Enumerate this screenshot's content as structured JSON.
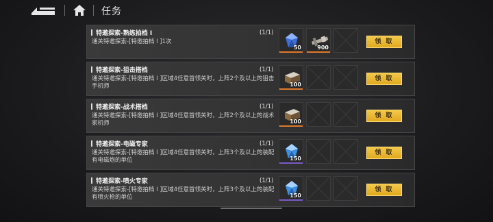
{
  "header": {
    "title": "任务",
    "back_icon": "back-arrow-icon",
    "home_icon": "home-icon"
  },
  "colors": {
    "claim_button": "#e8b32a",
    "rarity_orange": "#e07a2a",
    "rarity_purple": "#7a5ac8"
  },
  "tasks": [
    {
      "title": "特邀探索-熟练拍档 I",
      "description": "通关特邀探索-[特邀拍档 I ]1次",
      "progress": "(1/1)",
      "button": "领 取",
      "rewards": [
        {
          "icon": "blue-crystal-icon",
          "qty": "50",
          "rarity": "orange"
        },
        {
          "icon": "weapon-parts-icon",
          "qty": "900",
          "rarity": "orange"
        }
      ]
    },
    {
      "title": "特邀探索-狙击搭档",
      "description": "通关特邀探索-[特邀拍档 I ]区域4任意首领关时，上阵2个及以上的狙击手机师",
      "progress": "(1/1)",
      "button": "领 取",
      "rewards": [
        {
          "icon": "supply-crate-icon",
          "qty": "100",
          "rarity": "orange"
        }
      ]
    },
    {
      "title": "特邀探索-战术搭档",
      "description": "通关特邀探索-[特邀拍档 I ]区域4任意首领关时，上阵2个及以上的战术家机师",
      "progress": "(1/1)",
      "button": "领 取",
      "rewards": [
        {
          "icon": "supply-crate-icon",
          "qty": "100",
          "rarity": "orange"
        }
      ]
    },
    {
      "title": "特邀探索-电磁专家",
      "description": "通关特邀探索-[特邀拍档 I ]区域4任意首领关时，上阵3个及以上的装配有电磁炮的单位",
      "progress": "(1/1)",
      "button": "领 取",
      "rewards": [
        {
          "icon": "blue-crystal-icon",
          "qty": "150",
          "rarity": "purple"
        }
      ]
    },
    {
      "title": "特邀探索-喷火专家",
      "description": "通关特邀探索-[特邀拍档 I ]区域4任意首领关时，上阵3个及以上的装配有喷火枪的单位",
      "progress": "(1/1)",
      "button": "领 取",
      "rewards": [
        {
          "icon": "blue-crystal-icon",
          "qty": "150",
          "rarity": "purple"
        }
      ]
    }
  ]
}
